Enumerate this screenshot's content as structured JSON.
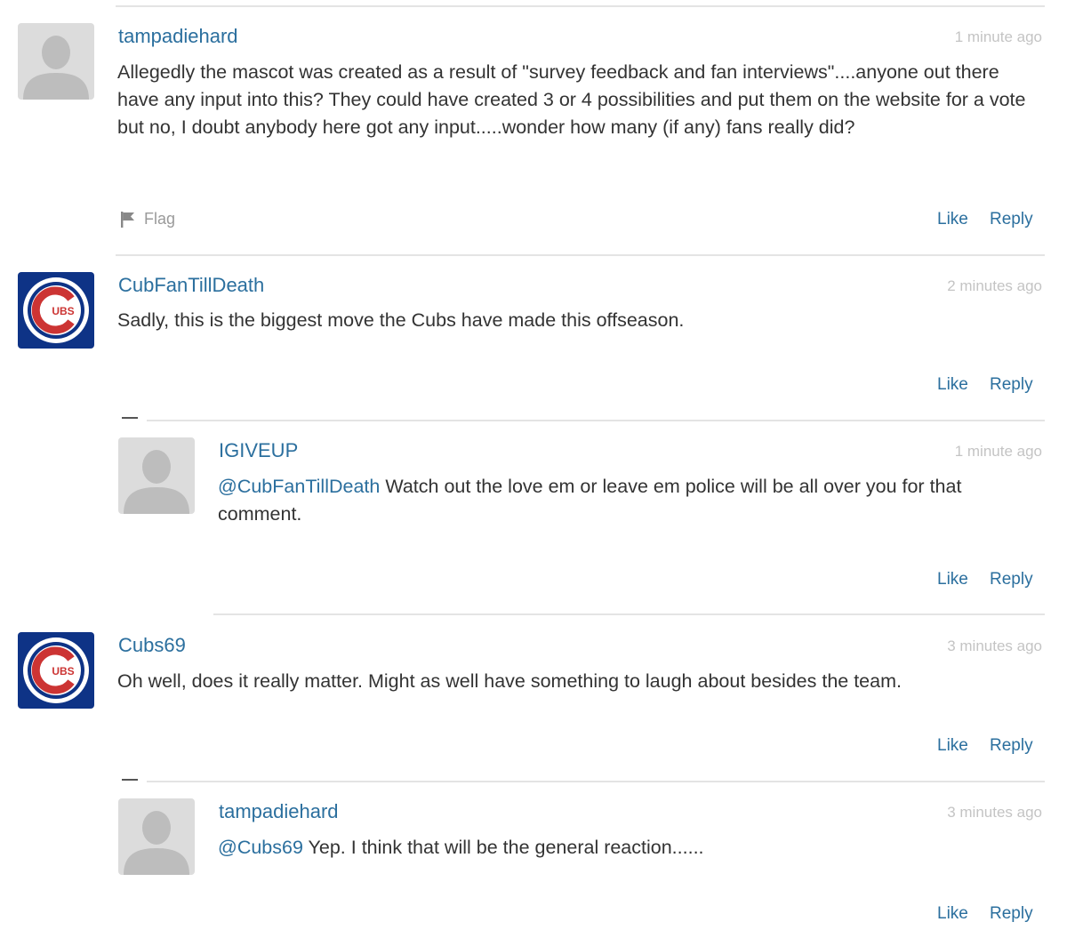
{
  "comments": [
    {
      "username": "tampadiehard",
      "time": "1 minute ago",
      "text": "Allegedly the mascot was created as a result of \"survey feedback and fan interviews\"....anyone out there have any input into this?  They could have created 3 or 4 possibilities and put them on the website for a vote but no, I doubt anybody here got any input.....wonder how many (if any) fans really did?",
      "flag_label": "Flag",
      "like_label": "Like",
      "reply_label": "Reply",
      "avatar": "default-user-avatar"
    },
    {
      "username": "CubFanTillDeath",
      "time": "2 minutes ago",
      "text": "Sadly, this is the biggest move the Cubs have made this offseason.",
      "like_label": "Like",
      "reply_label": "Reply",
      "avatar": "cubs-logo-avatar",
      "avatar_logo_text": "UBS",
      "replies": [
        {
          "username": "IGIVEUP",
          "time": "1 minute ago",
          "mention": "@CubFanTillDeath",
          "text": " Watch out the love em or leave em police will be all over you for that comment.",
          "like_label": "Like",
          "reply_label": "Reply",
          "avatar": "default-user-avatar"
        }
      ]
    },
    {
      "username": "Cubs69",
      "time": "3 minutes ago",
      "text": "Oh well, does it really matter. Might as well have something to laugh about besides the team.",
      "like_label": "Like",
      "reply_label": "Reply",
      "avatar": "cubs-logo-avatar",
      "avatar_logo_text": "UBS",
      "replies": [
        {
          "username": "tampadiehard",
          "time": "3 minutes ago",
          "mention": "@Cubs69",
          "text": " Yep.  I think that will be the general reaction......",
          "like_label": "Like",
          "reply_label": "Reply",
          "avatar": "default-user-avatar"
        }
      ]
    }
  ],
  "colors": {
    "link": "#2b6f9e",
    "timestamp": "#c4c4c4",
    "cubs_blue": "#0e3386",
    "cubs_red": "#cc3433"
  }
}
